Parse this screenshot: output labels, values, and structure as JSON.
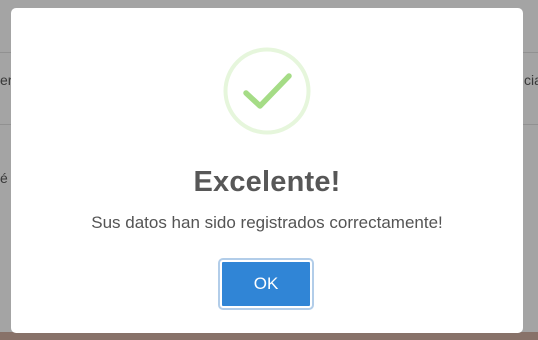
{
  "background": {
    "fragment_left_top": "er",
    "fragment_right_top": "cia",
    "fragment_left_mid": "é"
  },
  "dialog": {
    "icon": "checkmark-circle-icon",
    "title": "Excelente!",
    "message": "Sus datos han sido registrados correctamente!",
    "confirm_label": "OK"
  },
  "colors": {
    "success": "#a5dc86",
    "success_ring": "#e6f6dc",
    "confirm_button": "#3085d6",
    "title_text": "#575757",
    "message_text": "#545454"
  }
}
